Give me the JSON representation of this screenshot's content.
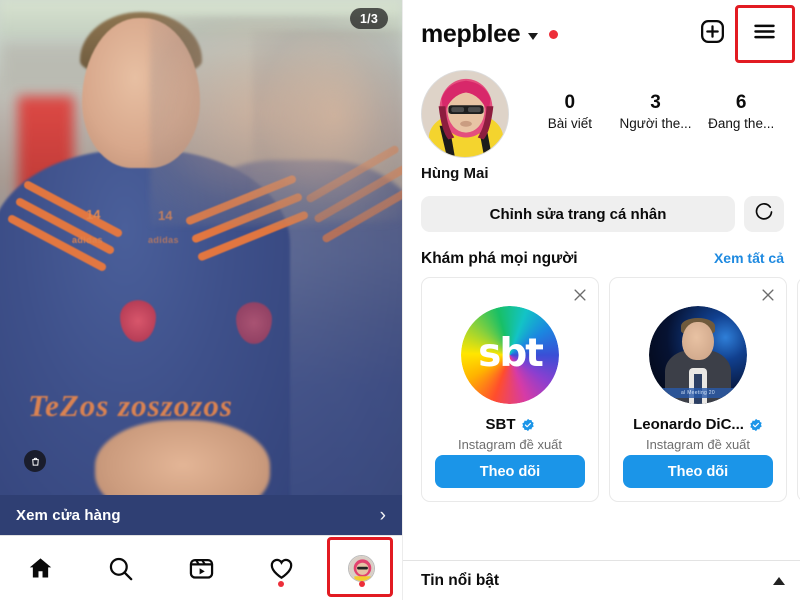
{
  "left_panel": {
    "carousel_indicator": "1/3",
    "shop_badge_icon": "shopping-bag-icon",
    "shop_bar": {
      "label": "Xem cửa hàng",
      "chevron": "›"
    },
    "bottom_nav": [
      {
        "name": "home",
        "icon": "home-icon",
        "active": true,
        "dot": false
      },
      {
        "name": "search",
        "icon": "search-icon",
        "active": false,
        "dot": false
      },
      {
        "name": "reels",
        "icon": "reels-icon",
        "active": false,
        "dot": false
      },
      {
        "name": "activity",
        "icon": "heart-icon",
        "active": false,
        "dot": true
      },
      {
        "name": "profile",
        "icon": "avatar-icon",
        "active": false,
        "dot": true
      }
    ],
    "photo": {
      "jersey_number": "14",
      "brand_text": "adidas",
      "sponsor_text": "TeZos"
    }
  },
  "right_panel": {
    "header": {
      "username": "mepblee",
      "chevron_icon": "chevron-down-icon",
      "unread_dot": true,
      "add_icon": "plus-square-icon",
      "menu_icon": "hamburger-menu-icon"
    },
    "profile": {
      "display_name": "Hùng Mai",
      "avatar_icon": "profile-avatar",
      "stats": [
        {
          "value": "0",
          "label": "Bài viết"
        },
        {
          "value": "3",
          "label": "Người the..."
        },
        {
          "value": "6",
          "label": "Đang the..."
        }
      ]
    },
    "actions": {
      "edit_profile_label": "Chỉnh sửa trang cá nhân",
      "discover_icon": "person-add-icon"
    },
    "discover": {
      "title": "Khám phá mọi người",
      "see_all_label": "Xem tất cả",
      "cards": [
        {
          "name": "SBT",
          "verified": true,
          "subtitle": "Instagram đề xuất",
          "follow_label": "Theo dõi",
          "dismiss_icon": "close-icon",
          "avatar_type": "sbt-rainbow-logo",
          "logo_text": "sbt"
        },
        {
          "name": "Leonardo DiC...",
          "verified": true,
          "subtitle": "Instagram đề xuất",
          "follow_label": "Theo dõi",
          "dismiss_icon": "close-icon",
          "avatar_type": "leonardo-photo",
          "banner_text": "al Meeting 20"
        }
      ]
    },
    "featured": {
      "title": "Tin nổi bật",
      "chevron_icon": "chevron-up-icon"
    }
  },
  "highlights": {
    "hamburger_box_color": "#e21b22",
    "profile_tab_box_color": "#e21b22"
  },
  "colors": {
    "accent_blue": "#1b95e8",
    "link_blue": "#1f8ae0",
    "red_dot": "#ed2f3a",
    "shop_bar": "#2f3f73",
    "highlight": "#e21b22"
  }
}
